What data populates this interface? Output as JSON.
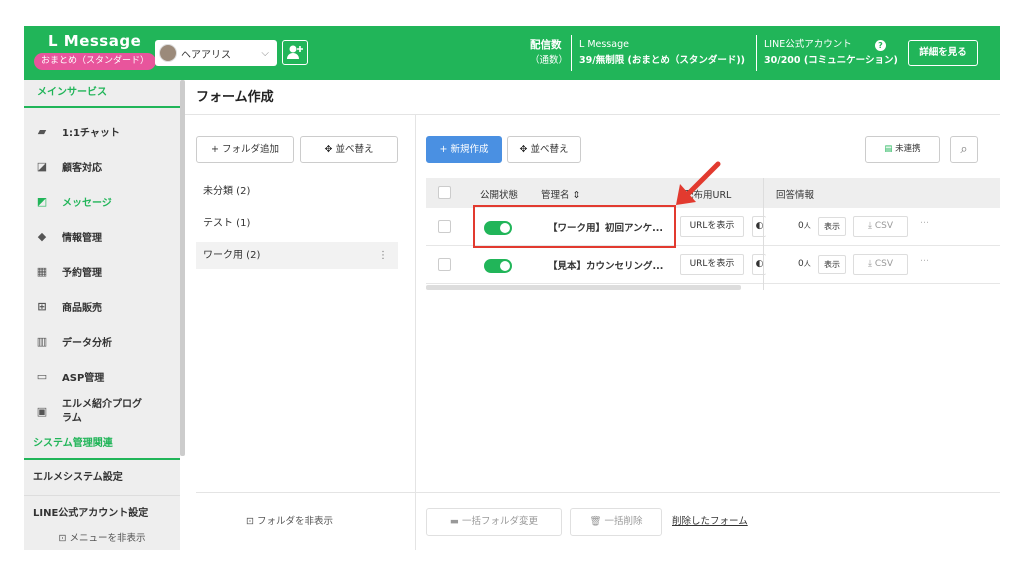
{
  "header": {
    "brand": "L Message",
    "plan": "おまとめ（スタンダード）",
    "account_name": "ヘアアリス",
    "delivery_label": "配信数",
    "delivery_sub": "（通数）",
    "plan_name": "L Message",
    "plan_detail": "39/無制限 (おまとめ（スタンダード))",
    "line_label": "LINE公式アカウント",
    "line_detail": "30/200 (コミュニケーション)",
    "detail_button": "詳細を見る"
  },
  "sidebar": {
    "section_main": "メインサービス",
    "items": [
      {
        "label": "1:1チャット",
        "icon": "chat-icon"
      },
      {
        "label": "顧客対応",
        "icon": "customer-icon"
      },
      {
        "label": "メッセージ",
        "icon": "message-icon"
      },
      {
        "label": "情報管理",
        "icon": "tag-icon"
      },
      {
        "label": "予約管理",
        "icon": "calendar-icon"
      },
      {
        "label": "商品販売",
        "icon": "cart-icon"
      },
      {
        "label": "データ分析",
        "icon": "chart-icon"
      },
      {
        "label": "ASP管理",
        "icon": "asp-icon"
      },
      {
        "label": "エルメ紹介プログラム",
        "icon": "referral-icon"
      }
    ],
    "section_system": "システム管理関連",
    "system_items": [
      "エルメシステム設定",
      "LINE公式アカウント設定"
    ],
    "hide_menu": "メニューを非表示"
  },
  "page": {
    "title": "フォーム作成"
  },
  "folders": {
    "add_button": "+ フォルダ追加",
    "sort_button": "並べ替え",
    "items": [
      "未分類 (2)",
      "テスト (1)",
      "ワーク用 (2)"
    ],
    "hide_button": "フォルダを非表示"
  },
  "toolbar": {
    "new_button": "+ 新規作成",
    "sort_button": "並べ替え",
    "unlinked_button": "未連携"
  },
  "table": {
    "headers": {
      "status": "公開状態",
      "name": "管理名",
      "url": "配布用URL",
      "answers": "回答情報"
    },
    "rows": [
      {
        "name": "【ワーク用】初回アンケ...",
        "url_button": "URLを表示",
        "count": "0",
        "unit": "人",
        "view": "表示",
        "csv": "CSV"
      },
      {
        "name": "【見本】カウンセリング...",
        "url_button": "URLを表示",
        "count": "0",
        "unit": "人",
        "view": "表示",
        "csv": "CSV"
      }
    ]
  },
  "footer": {
    "bulk_folder": "一括フォルダ変更",
    "bulk_delete": "一括削除",
    "deleted_forms": "削除したフォーム"
  },
  "colors": {
    "brand": "#21b559",
    "accent": "#4a90e2",
    "highlight": "#e23a2f",
    "plan_badge": "#e8559c"
  }
}
